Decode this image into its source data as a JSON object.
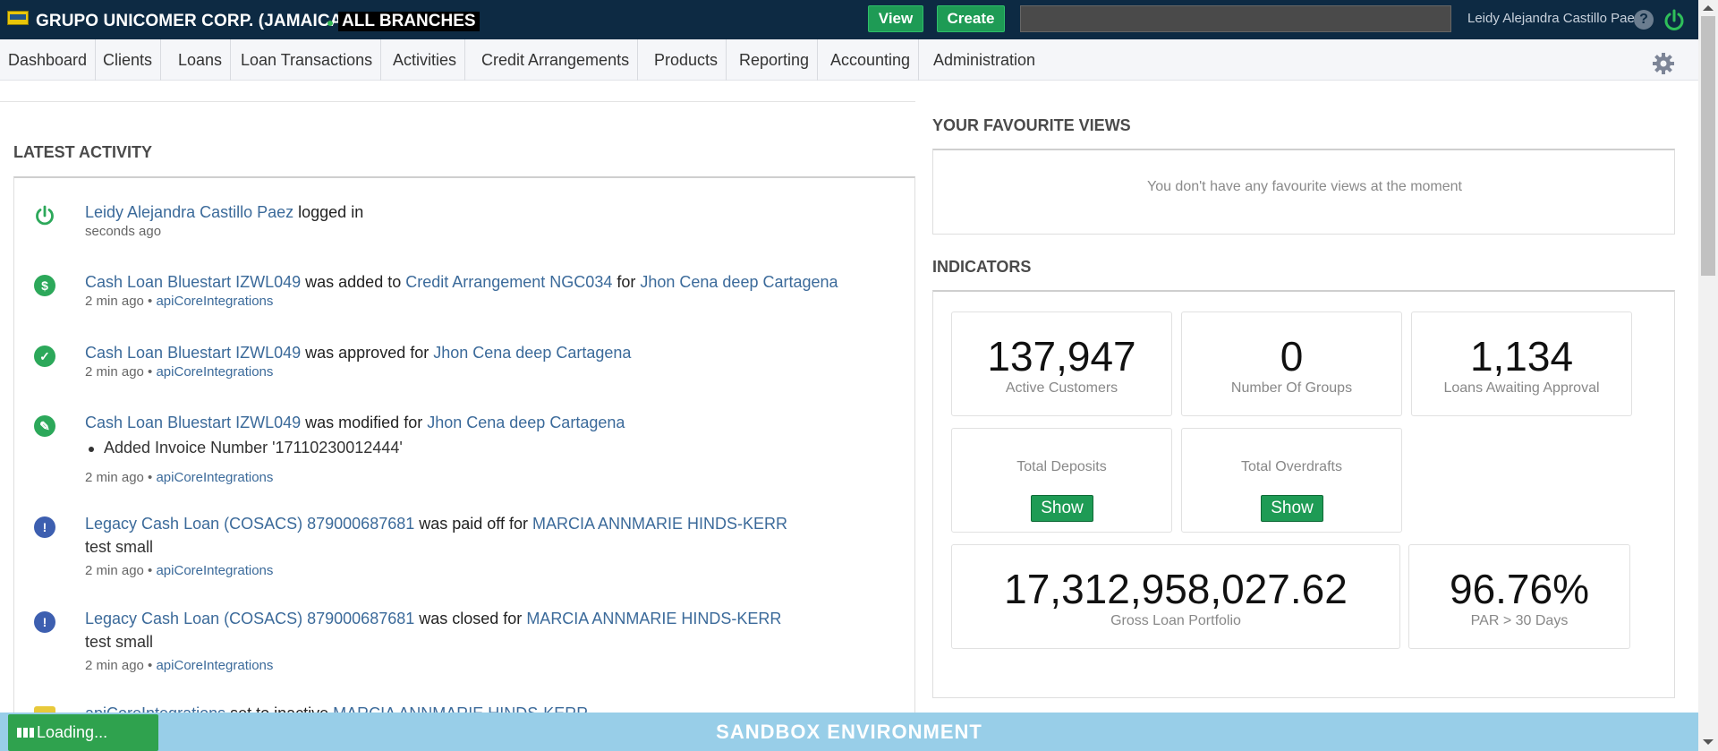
{
  "header": {
    "org_name": "GRUPO UNICOMER CORP. (JAMAICA)",
    "branch": "ALL BRANCHES",
    "view_label": "View",
    "create_label": "Create",
    "search_placeholder": "",
    "user_name": "Leidy Alejandra Castillo Paez",
    "help_glyph": "?"
  },
  "nav": {
    "items": [
      "Dashboard",
      "Clients",
      "Loans",
      "Loan  Transactions",
      "Activities",
      "Credit  Arrangements",
      "Products",
      "Reporting",
      "Accounting",
      "Administration"
    ]
  },
  "latest_activity": {
    "title": "LATEST ACTIVITY",
    "items": [
      {
        "icon": "power-icon",
        "actor": "Leidy Alejandra Castillo Paez",
        "text": " logged in",
        "time": "seconds ago"
      },
      {
        "icon": "dollar-icon",
        "link1": "Cash Loan Bluestart IZWL049",
        "text1": " was added to ",
        "link2": "Credit Arrangement NGC034",
        "text2": " for ",
        "link3": "Jhon Cena deep Cartagena",
        "time": "2 min ago",
        "sep": " • ",
        "by": "apiCoreIntegrations"
      },
      {
        "icon": "check-icon",
        "link1": "Cash Loan Bluestart IZWL049",
        "text1": " was approved for ",
        "link2": "Jhon Cena deep Cartagena",
        "time": "2 min ago",
        "sep": " • ",
        "by": "apiCoreIntegrations"
      },
      {
        "icon": "pencil-icon",
        "link1": "Cash Loan Bluestart IZWL049",
        "text1": " was modified for ",
        "link2": "Jhon Cena deep Cartagena",
        "bullet": "Added Invoice Number '17110230012444'",
        "time": "2 min ago",
        "sep": " • ",
        "by": "apiCoreIntegrations"
      },
      {
        "icon": "exclamation-icon",
        "link1": "Legacy Cash Loan (COSACS) 879000687681",
        "text1": " was paid off for ",
        "link2": "MARCIA ANNMARIE HINDS-KERR",
        "note": "test small",
        "time": "2 min ago",
        "sep": " • ",
        "by": "apiCoreIntegrations"
      },
      {
        "icon": "exclamation-icon",
        "link1": "Legacy Cash Loan (COSACS) 879000687681",
        "text1": " was closed for ",
        "link2": "MARCIA ANNMARIE HINDS-KERR",
        "note": "test small",
        "time": "2 min ago",
        "sep": " • ",
        "by": "apiCoreIntegrations"
      },
      {
        "icon": "user-icon",
        "link1": "apiCoreIntegrations",
        "text1": " set to inactive ",
        "link2": "MARCIA ANNMARIE HINDS-KERR"
      }
    ]
  },
  "favourites": {
    "title": "YOUR FAVOURITE VIEWS",
    "empty_message": "You don't have any favourite views at the moment"
  },
  "indicators": {
    "title": "INDICATORS",
    "active_customers": {
      "value": "137,947",
      "label": "Active Customers"
    },
    "groups": {
      "value": "0",
      "label": "Number Of Groups"
    },
    "awaiting": {
      "value": "1,134",
      "label": "Loans Awaiting Approval"
    },
    "deposits": {
      "label": "Total Deposits",
      "button": "Show"
    },
    "overdrafts": {
      "label": "Total Overdrafts",
      "button": "Show"
    },
    "portfolio": {
      "value": "17,312,958,027.62",
      "label": "Gross Loan Portfolio"
    },
    "par": {
      "value": "96.76%",
      "label": "PAR > 30 Days"
    }
  },
  "footer": {
    "sandbox": "SANDBOX ENVIRONMENT",
    "loading": "Loading..."
  },
  "colors": {
    "topbar": "#0d2a43",
    "accent_green": "#1e9b55",
    "link": "#3b6a9a",
    "sandbox": "#98cee8"
  }
}
